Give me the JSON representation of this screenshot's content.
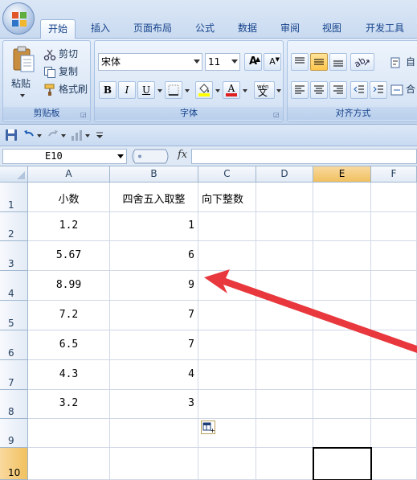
{
  "ribbon": {
    "tabs": [
      {
        "label": "开始",
        "active": true
      },
      {
        "label": "插入"
      },
      {
        "label": "页面布局"
      },
      {
        "label": "公式"
      },
      {
        "label": "数据"
      },
      {
        "label": "审阅"
      },
      {
        "label": "视图"
      },
      {
        "label": "开发工具"
      }
    ],
    "clipboard": {
      "paste_label": "粘贴",
      "cut_label": "剪切",
      "copy_label": "复制",
      "format_painter_label": "格式刷",
      "group_label": "剪贴板"
    },
    "font": {
      "font_name": "宋体",
      "font_size": "11",
      "bold": "B",
      "italic": "I",
      "underline": "U",
      "font_color_letter": "A",
      "wen_top": "wén",
      "wen_char": "文",
      "grow_letter": "A",
      "shrink_letter": "A",
      "group_label": "字体",
      "highlight_color": "#ffff00",
      "font_color": "#e02020"
    },
    "alignment": {
      "group_label": "对齐方式",
      "wrap_label": "自",
      "merge_label": "合"
    }
  },
  "qat": {
    "icons": [
      "save-icon",
      "undo-icon",
      "redo-icon",
      "chart-icon",
      "customize-icon"
    ]
  },
  "formula_bar": {
    "name_box": "E10",
    "fx_label": "fx",
    "formula": ""
  },
  "grid": {
    "columns": [
      "A",
      "B",
      "C",
      "D",
      "E",
      "F"
    ],
    "selected_column": "E",
    "rows": [
      "1",
      "2",
      "3",
      "4",
      "5",
      "6",
      "7",
      "8",
      "9",
      "10"
    ],
    "selected_row": "10",
    "headers": {
      "A1": "小数",
      "B1": "四舍五入取整",
      "C1": "向下整数"
    },
    "data": [
      {
        "a": "1.2",
        "b": "1"
      },
      {
        "a": "5.67",
        "b": "6"
      },
      {
        "a": "8.99",
        "b": "9"
      },
      {
        "a": "7.2",
        "b": "7"
      },
      {
        "a": "6.5",
        "b": "7"
      },
      {
        "a": "4.3",
        "b": "4"
      },
      {
        "a": "3.2",
        "b": "3"
      }
    ]
  },
  "annotation": {
    "arrow_color": "#e8383d"
  }
}
